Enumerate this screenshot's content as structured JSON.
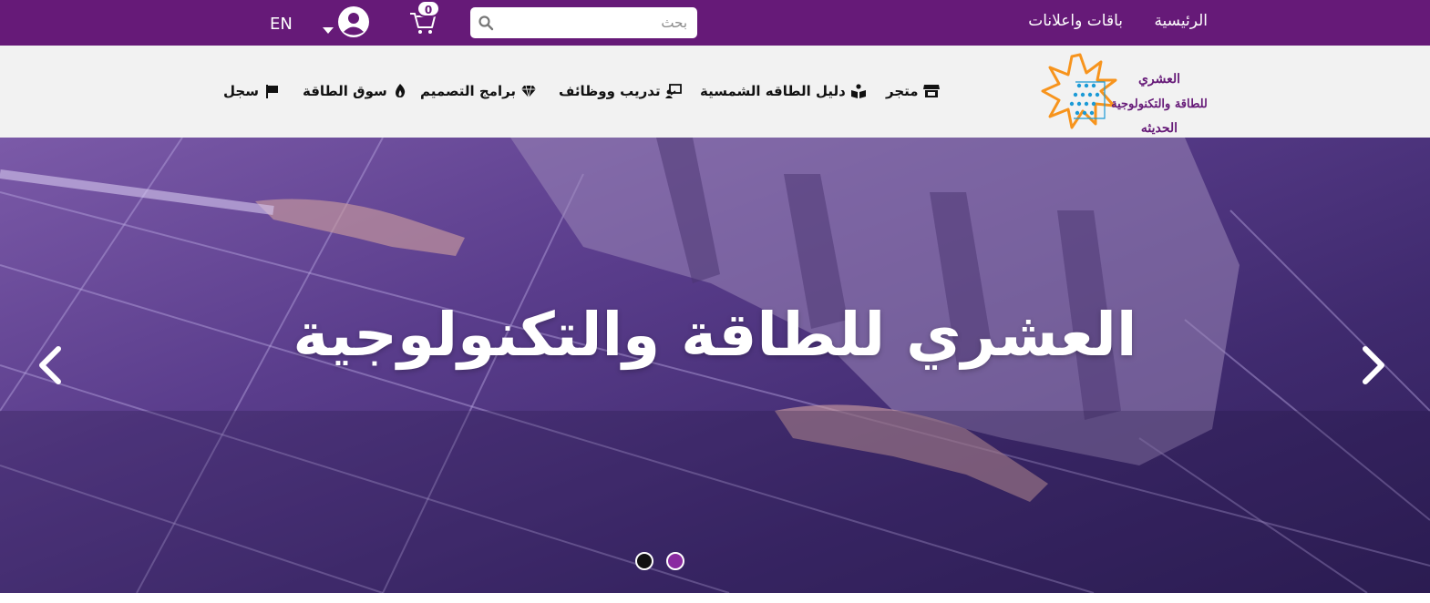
{
  "topbar": {
    "links": [
      "الرئيسية",
      "باقات واعلانات"
    ],
    "search_placeholder": "بحث",
    "cart_count": "0",
    "language": "EN",
    "colors": {
      "bar": "#661a78",
      "text": "#ffffff"
    },
    "icons": [
      "search-icon",
      "cart-icon",
      "user-circle-icon",
      "caret-down-icon"
    ]
  },
  "logo": {
    "lines": [
      "العشري",
      "للطاقة والتكنولوجية",
      "الحديثه"
    ]
  },
  "nav": {
    "items": [
      {
        "label": "متجر",
        "icon": "store-icon"
      },
      {
        "label": "دليل الطاقه الشمسية",
        "icon": "book-reader-icon"
      },
      {
        "label": "تدريب ووظائف",
        "icon": "teacher-icon"
      },
      {
        "label": "برامج التصميم",
        "icon": "gem-icon"
      },
      {
        "label": "سوق الطاقة",
        "icon": "fire-icon"
      },
      {
        "label": "سجل",
        "icon": "flag-icon"
      }
    ]
  },
  "hero": {
    "title": "العشري للطاقة والتكنولوجية",
    "active_slide": 1,
    "slide_count": 2,
    "icons": [
      "chevron-left-icon",
      "chevron-right-icon"
    ]
  }
}
